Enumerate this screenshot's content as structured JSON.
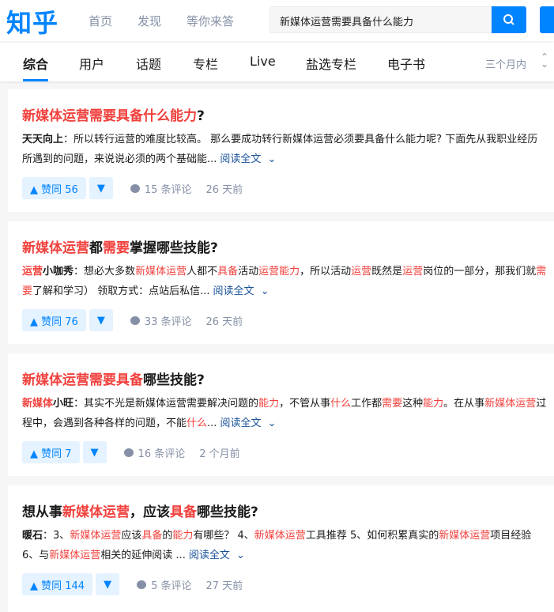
{
  "header": {
    "logo": "知乎",
    "nav": [
      "首页",
      "发现",
      "等你来答"
    ],
    "search_value": "新媒体运营需要具备什么能力",
    "accent": "#0084ff"
  },
  "tabs": {
    "items": [
      "综合",
      "用户",
      "话题",
      "专栏",
      "Live",
      "盐选专栏",
      "电子书"
    ],
    "active": 0,
    "filter": "三个月内"
  },
  "highlight_color": "#f1403c",
  "results": [
    {
      "title": [
        [
          "新媒体运营需要具备什么能力",
          1
        ],
        [
          "?",
          0
        ]
      ],
      "author": [
        [
          "天天向上",
          0
        ]
      ],
      "excerpt": [
        [
          "所以转行运营的难度比较高。 那么要成功转行新媒体运营必须要具备什么能力呢? 下面先从我职业经历所遇到的问题，来说说必须的两个基础能...",
          0
        ]
      ],
      "more": "阅读全文",
      "vote_up": "赞同 56",
      "comments": "15 条评论",
      "time": "26 天前"
    },
    {
      "title": [
        [
          "新媒体运营",
          1
        ],
        [
          "都",
          0
        ],
        [
          "需要",
          1
        ],
        [
          "掌握哪些技能?",
          0
        ]
      ],
      "author": [
        [
          "运营",
          1
        ],
        [
          "小咖秀",
          0
        ]
      ],
      "excerpt": [
        [
          "想必大多数",
          0
        ],
        [
          "新媒体运营",
          1
        ],
        [
          "人都不",
          0
        ],
        [
          "具备",
          1
        ],
        [
          "活动",
          0
        ],
        [
          "运营能力",
          1
        ],
        [
          "，所以活动",
          0
        ],
        [
          "运营",
          1
        ],
        [
          "既然是",
          0
        ],
        [
          "运营",
          1
        ],
        [
          "岗位的一部分，那我们就",
          0
        ],
        [
          "需要",
          1
        ],
        [
          "了解和学习） 领取方式：点站后私信...",
          0
        ]
      ],
      "more": "阅读全文",
      "vote_up": "赞同 76",
      "comments": "33 条评论",
      "time": "26 天前"
    },
    {
      "title": [
        [
          "新媒体运营需要具备",
          1
        ],
        [
          "哪些技能?",
          0
        ]
      ],
      "author": [
        [
          "新媒体",
          1
        ],
        [
          "小旺",
          0
        ]
      ],
      "excerpt": [
        [
          "其实不光是新媒体运营需要解决问题的",
          0
        ],
        [
          "能力",
          1
        ],
        [
          "，不管从事",
          0
        ],
        [
          "什么",
          1
        ],
        [
          "工作都",
          0
        ],
        [
          "需要",
          1
        ],
        [
          "这种",
          0
        ],
        [
          "能力",
          1
        ],
        [
          "。在从事",
          0
        ],
        [
          "新媒体运营",
          1
        ],
        [
          "过程中，会遇到各种各样的问题，不能",
          0
        ],
        [
          "什么",
          1
        ],
        [
          "...",
          0
        ]
      ],
      "more": "阅读全文",
      "vote_up": "赞同 7",
      "comments": "16 条评论",
      "time": "2 个月前"
    },
    {
      "title": [
        [
          "想从事",
          0
        ],
        [
          "新媒体运营",
          1
        ],
        [
          "，应该",
          0
        ],
        [
          "具备",
          1
        ],
        [
          "哪些技能?",
          0
        ]
      ],
      "author": [
        [
          "暖石",
          0
        ]
      ],
      "excerpt": [
        [
          "3、",
          0
        ],
        [
          "新媒体运营",
          1
        ],
        [
          "应该",
          0
        ],
        [
          "具备",
          1
        ],
        [
          "的",
          0
        ],
        [
          "能力",
          1
        ],
        [
          "有哪些？ 4、",
          0
        ],
        [
          "新媒体运营",
          1
        ],
        [
          "工具推荐 5、如何积累真实的",
          0
        ],
        [
          "新媒体运营",
          1
        ],
        [
          "项目经验 6、与",
          0
        ],
        [
          "新媒体运营",
          1
        ],
        [
          "相关的延伸阅读 ...",
          0
        ]
      ],
      "more": "阅读全文",
      "vote_up": "赞同 144",
      "comments": "5 条评论",
      "time": "27 天前"
    }
  ]
}
